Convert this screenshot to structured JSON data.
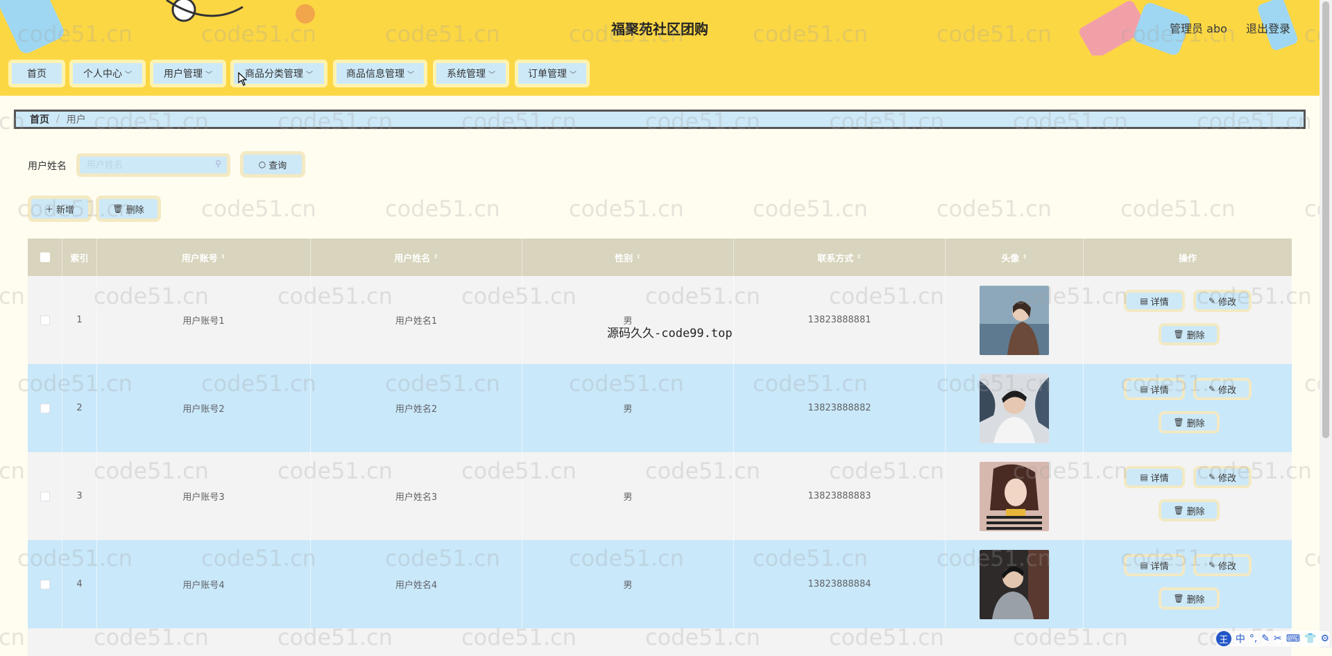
{
  "header": {
    "title": "福聚苑社区团购",
    "admin": "管理员 abo",
    "logout": "退出登录"
  },
  "nav": [
    {
      "label": "首页",
      "dropdown": false
    },
    {
      "label": "个人中心",
      "dropdown": true
    },
    {
      "label": "用户管理",
      "dropdown": true
    },
    {
      "label": "商品分类管理",
      "dropdown": true
    },
    {
      "label": "商品信息管理",
      "dropdown": true
    },
    {
      "label": "系统管理",
      "dropdown": true
    },
    {
      "label": "订单管理",
      "dropdown": true
    }
  ],
  "breadcrumb": {
    "home": "首页",
    "current": "用户"
  },
  "search": {
    "label": "用户姓名",
    "placeholder": "用户姓名",
    "button": "查询"
  },
  "actions": {
    "add": "新增",
    "delete": "删除"
  },
  "table": {
    "headers": [
      "索引",
      "用户账号",
      "用户姓名",
      "性别",
      "联系方式",
      "头像",
      "操作"
    ],
    "rows": [
      {
        "index": "1",
        "account": "用户账号1",
        "name": "用户姓名1",
        "gender": "男",
        "phone": "13823888881"
      },
      {
        "index": "2",
        "account": "用户账号2",
        "name": "用户姓名2",
        "gender": "男",
        "phone": "13823888882"
      },
      {
        "index": "3",
        "account": "用户账号3",
        "name": "用户姓名3",
        "gender": "男",
        "phone": "13823888883"
      },
      {
        "index": "4",
        "account": "用户账号4",
        "name": "用户姓名4",
        "gender": "男",
        "phone": "13823888884"
      }
    ],
    "ops": {
      "detail": "详情",
      "edit": "修改",
      "delete": "删除"
    }
  },
  "watermark": "code51.cn",
  "center_note": "源码久久-code99.top",
  "ime": [
    "王",
    "中",
    "°,",
    "✎",
    "✂",
    "⌨",
    "👕",
    "⚙"
  ],
  "colors": {
    "header_bg": "#fcd744",
    "button_bg": "#cde9f8",
    "row_alt": "#c9e8fa",
    "thead_bg": "#d8d4bd"
  }
}
